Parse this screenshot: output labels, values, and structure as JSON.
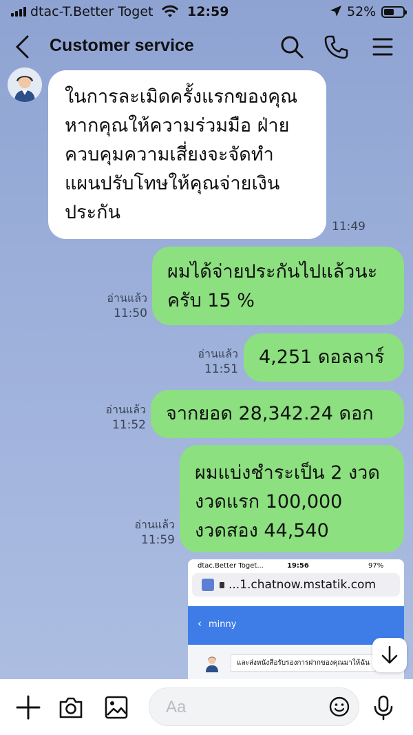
{
  "status_bar": {
    "carrier": "dtac-T.Better Toget",
    "time": "12:59",
    "battery": "52%",
    "battery_level": 0.52,
    "icons": [
      "signal-icon",
      "wifi-icon",
      "location-arrow-icon",
      "battery-icon"
    ]
  },
  "header": {
    "title": "Customer service",
    "icons": [
      "back-chevron-icon",
      "search-icon",
      "phone-icon",
      "menu-icon"
    ]
  },
  "messages": [
    {
      "direction": "incoming",
      "lines": [
        "ในการละเมิดครั้งแรกของคุณ",
        "หากคุณให้ความร่วมมือ ฝ่าย",
        "ควบคุมความเสี่ยงจะจัดทำ",
        "แผนปรับโทษให้คุณจ่ายเงิน",
        "ประกัน"
      ],
      "time": "11:49"
    },
    {
      "direction": "outgoing",
      "lines": [
        "ผมได้จ่ายประกันไปแล้วนะ",
        "ครับ 15 %"
      ],
      "read": "อ่านแล้ว",
      "time": "11:50"
    },
    {
      "direction": "outgoing",
      "lines": [
        "4,251 ดอลลาร์"
      ],
      "read": "อ่านแล้ว",
      "time": "11:51"
    },
    {
      "direction": "outgoing",
      "lines": [
        "จากยอด 28,342.24 ดอก"
      ],
      "read": "อ่านแล้ว",
      "time": "11:52"
    },
    {
      "direction": "outgoing",
      "lines": [
        "ผมแบ่งชำระเป็น 2 งวด",
        "งวดแรก 100,000",
        "งวดสอง 44,540"
      ],
      "read": "อ่านแล้ว",
      "time": "11:59"
    }
  ],
  "screenshot_preview": {
    "carrier": "dtac.Better Toget...",
    "time": "19:56",
    "battery": "97%",
    "url": "...1.chatnow.mstatik.com",
    "chat_name": "minny",
    "message": "และส่งหนังสือรับรองการฝากของคุณมาให้ฉัน"
  },
  "composer": {
    "placeholder": "Aa"
  },
  "colors": {
    "background": "#9aaed9",
    "incoming_bubble": "#ffffff",
    "outgoing_bubble": "#8ce07f",
    "preview_bar": "#3e7ce8"
  }
}
